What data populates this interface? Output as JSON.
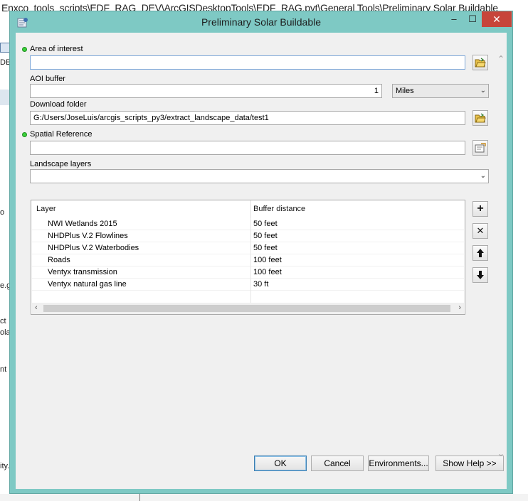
{
  "background": {
    "path_text": "Enxco_tools_scripts\\EDF_RAG_DEV\\ArcGISDesktopTools\\EDF_RAG.pyt\\General Tools\\Preliminary Solar Buildable",
    "fragments": [
      "DEV",
      "o",
      "e.g",
      "ct",
      "ola",
      "nt",
      "ity."
    ]
  },
  "window": {
    "title": "Preliminary Solar Buildable",
    "min_glyph": "–",
    "max_glyph": "☐",
    "close_glyph": "✕"
  },
  "form": {
    "aoi": {
      "label": "Area of interest",
      "value": ""
    },
    "aoi_buffer": {
      "label": "AOI buffer",
      "value": "1",
      "unit": "Miles"
    },
    "download_folder": {
      "label": "Download folder",
      "value": "G:/Users/JoseLuis/arcgis_scripts_py3/extract_landscape_data/test1"
    },
    "spatial_reference": {
      "label": "Spatial Reference",
      "value": ""
    },
    "landscape_layers": {
      "label": "Landscape layers",
      "value": ""
    }
  },
  "table": {
    "headers": [
      "Layer",
      "Buffer distance"
    ],
    "rows": [
      {
        "layer": "NWI Wetlands 2015",
        "distance": "50 feet"
      },
      {
        "layer": "NHDPlus V.2 Flowlines",
        "distance": "50 feet"
      },
      {
        "layer": "NHDPlus V.2  Waterbodies",
        "distance": "50 feet"
      },
      {
        "layer": "Roads",
        "distance": "100 feet"
      },
      {
        "layer": "Ventyx transmission",
        "distance": "100 feet"
      },
      {
        "layer": "Ventyx natural gas line",
        "distance": "30 ft"
      }
    ],
    "side_buttons": {
      "add": "+",
      "remove": "✕",
      "up": "🡅",
      "down": "🡇"
    }
  },
  "buttons": {
    "ok": "OK",
    "cancel": "Cancel",
    "environments": "Environments...",
    "show_help": "Show Help >>"
  }
}
